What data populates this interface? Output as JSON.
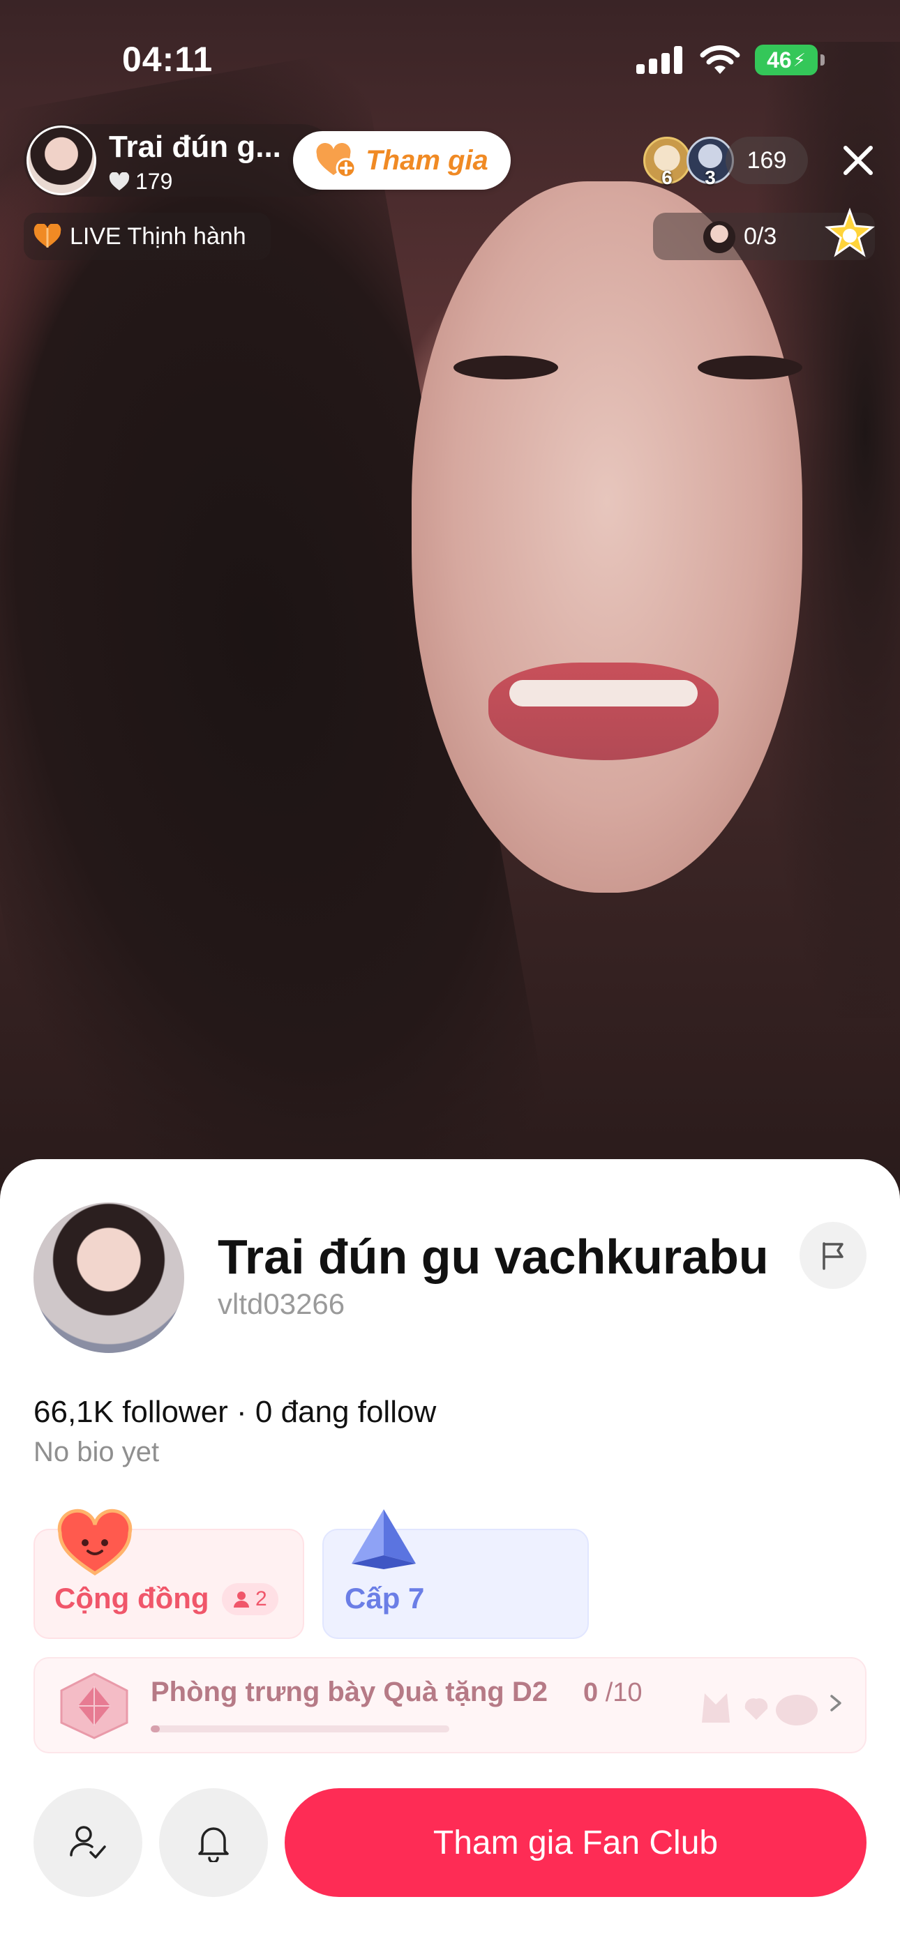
{
  "status_bar": {
    "time": "04:11",
    "battery": "46"
  },
  "live_header": {
    "host_name": "Trai đún g...",
    "host_likes": "179",
    "join_label": "Tham gia",
    "trending_label": "LIVE Thịnh hành",
    "top_viewers": [
      {
        "rank": "6"
      },
      {
        "rank": "3"
      }
    ],
    "viewer_count": "169",
    "goal_progress": "0/3"
  },
  "profile": {
    "display_name": "Trai đún gu vachkurabu",
    "username": "vltd03266",
    "stats": "66,1K follower · 0 đang follow",
    "bio": "No bio yet"
  },
  "community_card": {
    "label": "Cộng đồng",
    "member_count": "2"
  },
  "level_card": {
    "label": "Cấp 7"
  },
  "gift_gallery": {
    "label": "Phòng trưng bày Quà tặng D2",
    "current": "0",
    "total": "/10",
    "progress": 0.03
  },
  "actions": {
    "fanclub_label": "Tham gia Fan Club"
  },
  "colors": {
    "primary": "#fe2c55",
    "join_orange": "#f08a24",
    "community_pink": "#f0566a",
    "level_blue": "#6b7ee6"
  }
}
